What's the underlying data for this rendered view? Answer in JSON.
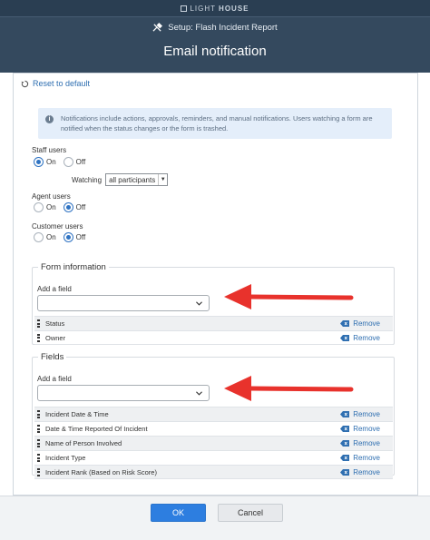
{
  "topbar": {
    "logo_light": "LIGHT",
    "logo_bold": "HOUSE"
  },
  "header": {
    "setup_label": "Setup: Flash Incident Report",
    "title": "Email notification"
  },
  "reset_label": "Reset to default",
  "info_text": "Notifications include actions, approvals, reminders, and manual notifications. Users watching a form are notified when the status changes or the form is trashed.",
  "staff": {
    "label": "Staff users",
    "on": "On",
    "off": "Off",
    "selected": "On",
    "watching_label": "Watching",
    "watching_value": "all participants"
  },
  "agent": {
    "label": "Agent users",
    "on": "On",
    "off": "Off",
    "selected": "Off"
  },
  "customer": {
    "label": "Customer users",
    "on": "On",
    "off": "Off",
    "selected": "Off"
  },
  "form_information": {
    "legend": "Form information",
    "add_label": "Add a field",
    "rows": [
      {
        "name": "Status",
        "action": "Remove"
      },
      {
        "name": "Owner",
        "action": "Remove"
      }
    ]
  },
  "fields": {
    "legend": "Fields",
    "add_label": "Add a field",
    "rows": [
      {
        "name": "Incident Date & Time",
        "action": "Remove"
      },
      {
        "name": "Date & Time Reported Of Incident",
        "action": "Remove"
      },
      {
        "name": "Name of Person Involved",
        "action": "Remove"
      },
      {
        "name": "Incident Type",
        "action": "Remove"
      },
      {
        "name": "Incident Rank (Based on Risk Score)",
        "action": "Remove"
      }
    ]
  },
  "footer": {
    "ok_label": "OK",
    "cancel_label": "Cancel"
  },
  "colors": {
    "header": "#34495e",
    "accent": "#2d7ee0",
    "annotation_arrow": "#e8322c"
  }
}
